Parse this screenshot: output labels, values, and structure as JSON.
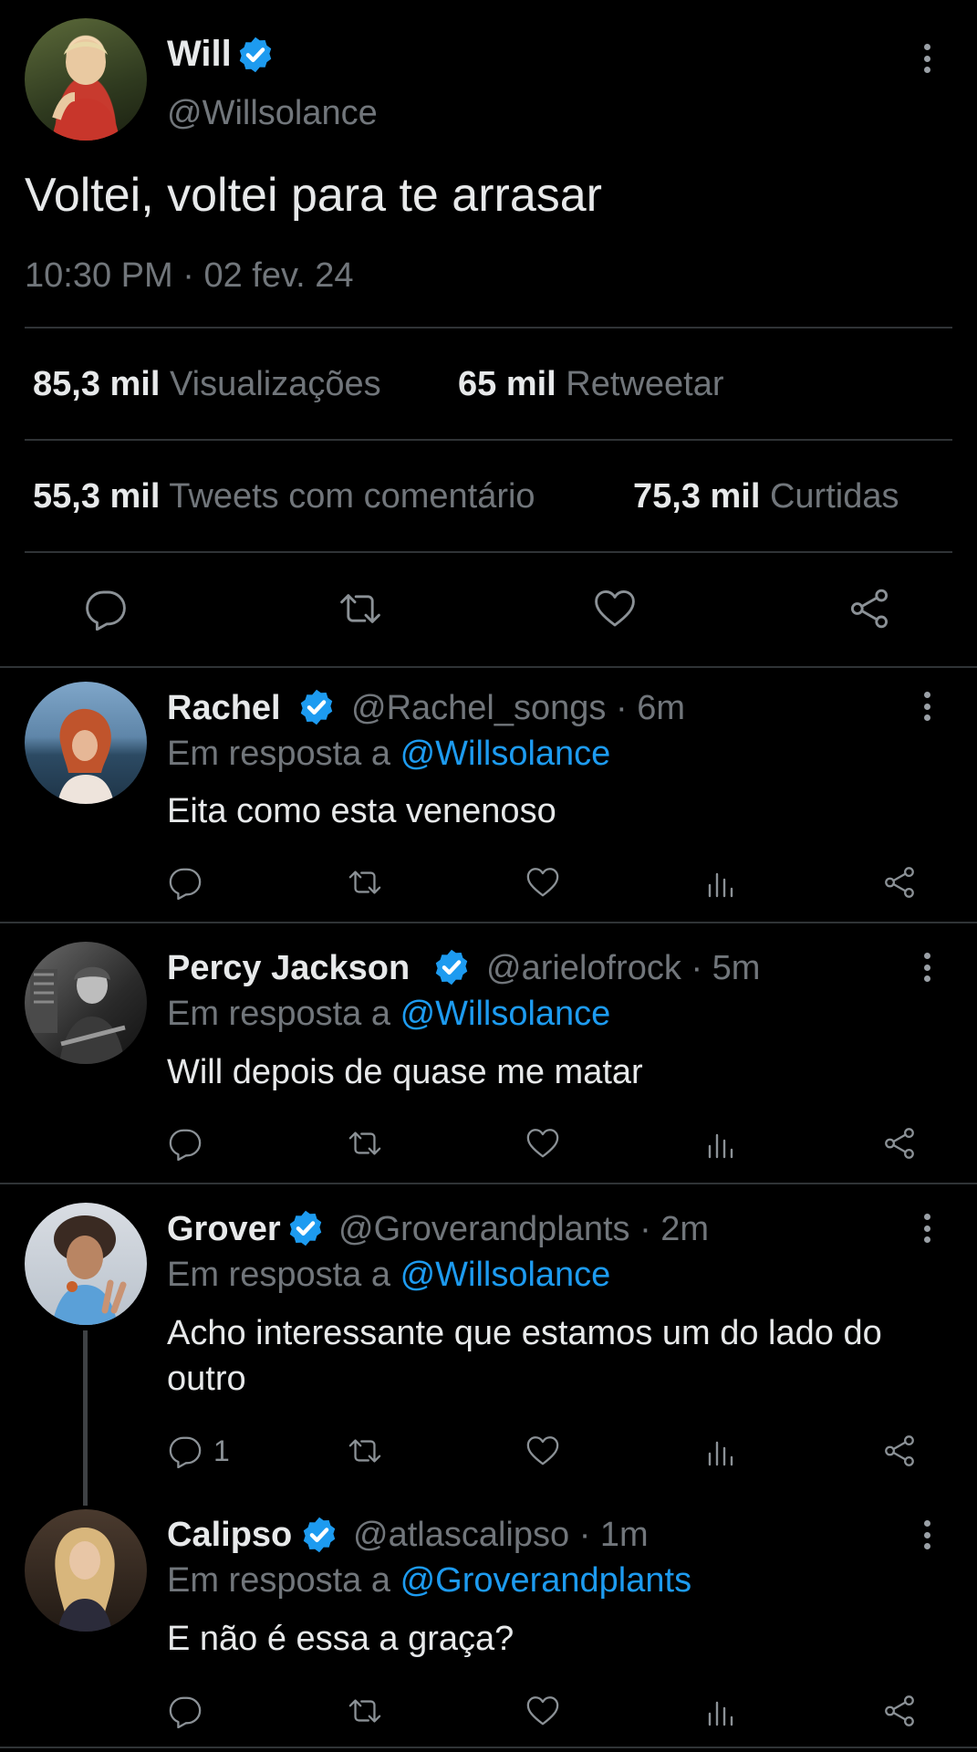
{
  "main_tweet": {
    "name": "Will",
    "handle": "@Willsolance",
    "text": "Voltei, voltei para te arrasar",
    "time": "10:30 PM",
    "separator": "·",
    "date": "02 fev. 24",
    "stats": {
      "views_count": "85,3 mil",
      "views_label": "Visualizações",
      "retweets_count": "65 mil",
      "retweets_label": "Retweetar",
      "quotes_count": "55,3 mil",
      "quotes_label": "Tweets com comentário",
      "likes_count": "75,3 mil",
      "likes_label": "Curtidas"
    }
  },
  "reply_prefix": "Em resposta a",
  "replies": [
    {
      "name": "Rachel",
      "handle": "@Rachel_songs",
      "sep": "·",
      "time": "6m",
      "reply_to": "@Willsolance",
      "text": "Eita como esta venenoso",
      "reply_count": ""
    },
    {
      "name": "Percy Jackson",
      "handle": "@arielofrock",
      "sep": "·",
      "time": "5m",
      "reply_to": "@Willsolance",
      "text": "Will depois de quase me matar",
      "reply_count": ""
    },
    {
      "name": "Grover",
      "handle": "@Groverandplants",
      "sep": "·",
      "time": "2m",
      "reply_to": "@Willsolance",
      "text": "Acho interessante que estamos um do lado do outro",
      "reply_count": "1"
    },
    {
      "name": "Calipso",
      "handle": "@atlascalipso",
      "sep": "·",
      "time": "1m",
      "reply_to": "@Groverandplants",
      "text": "E não é essa a graça?",
      "reply_count": ""
    }
  ],
  "colors": {
    "background": "#000000",
    "text": "#e7e9ea",
    "secondary": "#71767b",
    "accent": "#1d9bf0",
    "divider": "#2f3336"
  },
  "icons": [
    "verified-badge-icon",
    "more-options-icon",
    "reply-icon",
    "retweet-icon",
    "like-icon",
    "views-icon",
    "share-icon"
  ]
}
